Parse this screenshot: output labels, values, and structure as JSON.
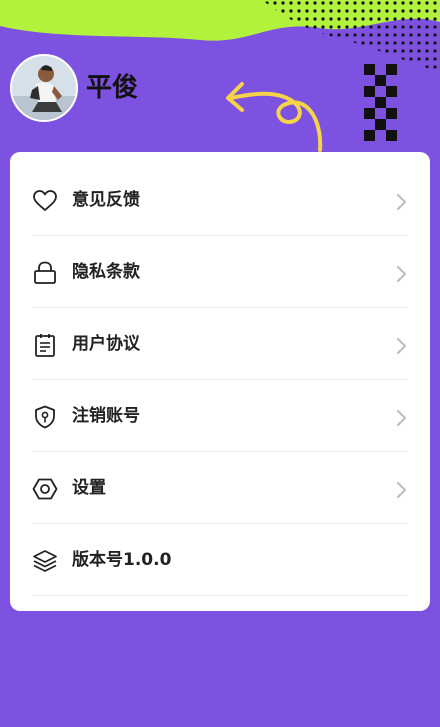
{
  "profile": {
    "name": "平俊"
  },
  "menu": {
    "items": [
      {
        "label": "意见反馈",
        "icon": "heart-icon"
      },
      {
        "label": "隐私条款",
        "icon": "lock-icon"
      },
      {
        "label": "用户协议",
        "icon": "document-icon"
      },
      {
        "label": "注销账号",
        "icon": "shield-key-icon"
      },
      {
        "label": "设置",
        "icon": "hexagon-settings-icon"
      },
      {
        "label": "版本号1.0.0",
        "icon": "layers-icon"
      }
    ]
  },
  "colors": {
    "background": "#7d52e0",
    "accent_green": "#b3f23c",
    "accent_yellow": "#f5d547",
    "card": "#ffffff"
  }
}
